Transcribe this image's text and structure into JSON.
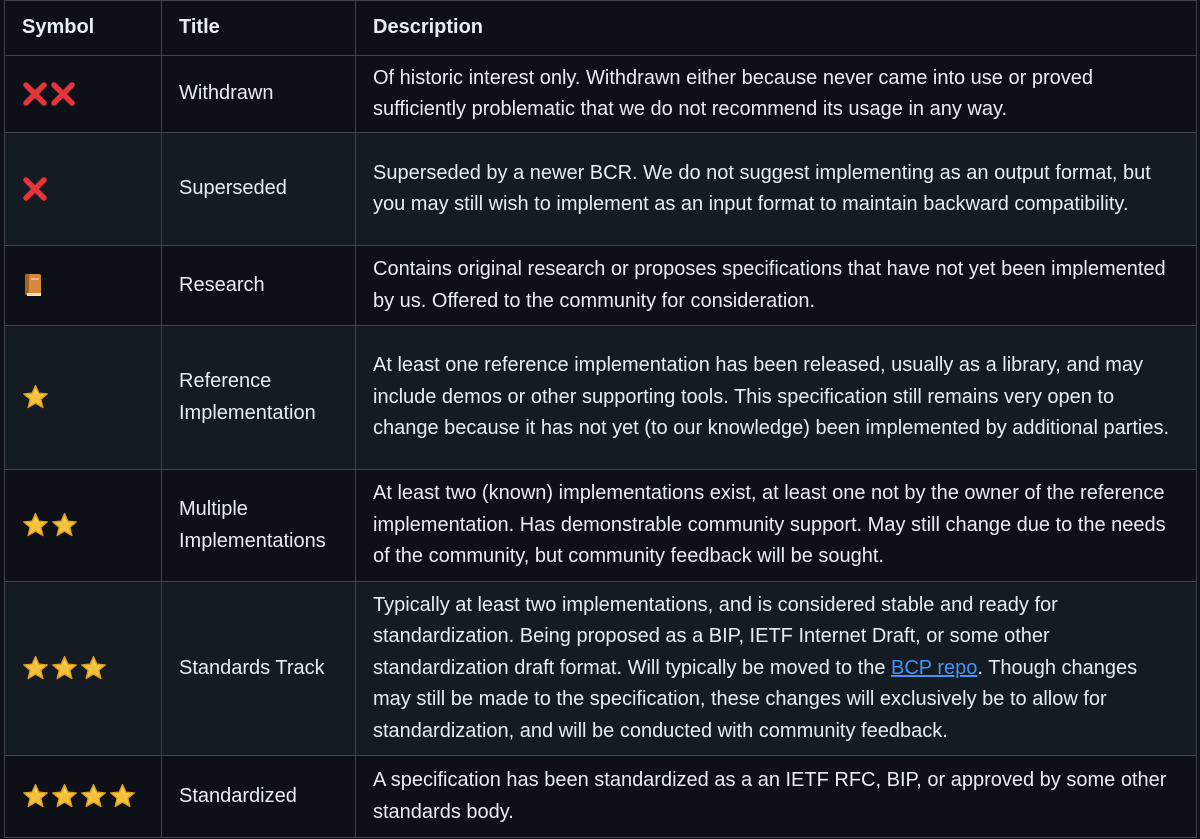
{
  "table": {
    "headers": {
      "symbol": "Symbol",
      "title": "Title",
      "description": "Description"
    },
    "rows": [
      {
        "symbol_icons": [
          "cross-mark-icon",
          "cross-mark-icon"
        ],
        "title": "Withdrawn",
        "description": "Of historic interest only. Withdrawn either because never came into use or proved sufficiently problematic that we do not recommend its usage in any way."
      },
      {
        "symbol_icons": [
          "cross-mark-icon"
        ],
        "title": "Superseded",
        "description": "Superseded by a newer BCR. We do not suggest implementing as an output format, but you may still wish to implement as an input format to maintain backward compatibility."
      },
      {
        "symbol_icons": [
          "book-icon"
        ],
        "title": "Research",
        "description": "Contains original research or proposes specifications that have not yet been implemented by us. Offered to the community for consideration."
      },
      {
        "symbol_icons": [
          "star-icon"
        ],
        "title": "Reference Implementation",
        "description": "At least one reference implementation has been released, usually as a library, and may include demos or other supporting tools. This specification still remains very open to change because it has not yet (to our knowledge) been implemented by additional parties."
      },
      {
        "symbol_icons": [
          "star-icon",
          "star-icon"
        ],
        "title": "Multiple Implementations",
        "description": "At least two (known) implementations exist, at least one not by the owner of the reference implementation. Has demonstrable community support. May still change due to the needs of the community, but community feedback will be sought."
      },
      {
        "symbol_icons": [
          "star-icon",
          "star-icon",
          "star-icon"
        ],
        "title": "Standards Track",
        "description_before_link": "Typically at least two implementations, and is considered stable and ready for standardization. Being proposed as a BIP, IETF Internet Draft, or some other standardization draft format. Will typically be moved to the ",
        "link_text": "BCP repo",
        "description_after_link": ". Though changes may still be made to the specification, these changes will exclusively be to allow for standardization, and will be conducted with community feedback."
      },
      {
        "symbol_icons": [
          "star-icon",
          "star-icon",
          "star-icon",
          "star-icon"
        ],
        "title": "Standardized",
        "description": "A specification has been standardized as a an IETF RFC, BIP, or approved by some other standards body."
      }
    ]
  },
  "colors": {
    "background": "#0d1117",
    "row_alt_background": "#151b23",
    "border": "#3d444d",
    "text": "#e6edf3",
    "link": "#4493f8",
    "cross": "#e5343a",
    "star": "#f5c33b",
    "book": "#d68a3c"
  }
}
